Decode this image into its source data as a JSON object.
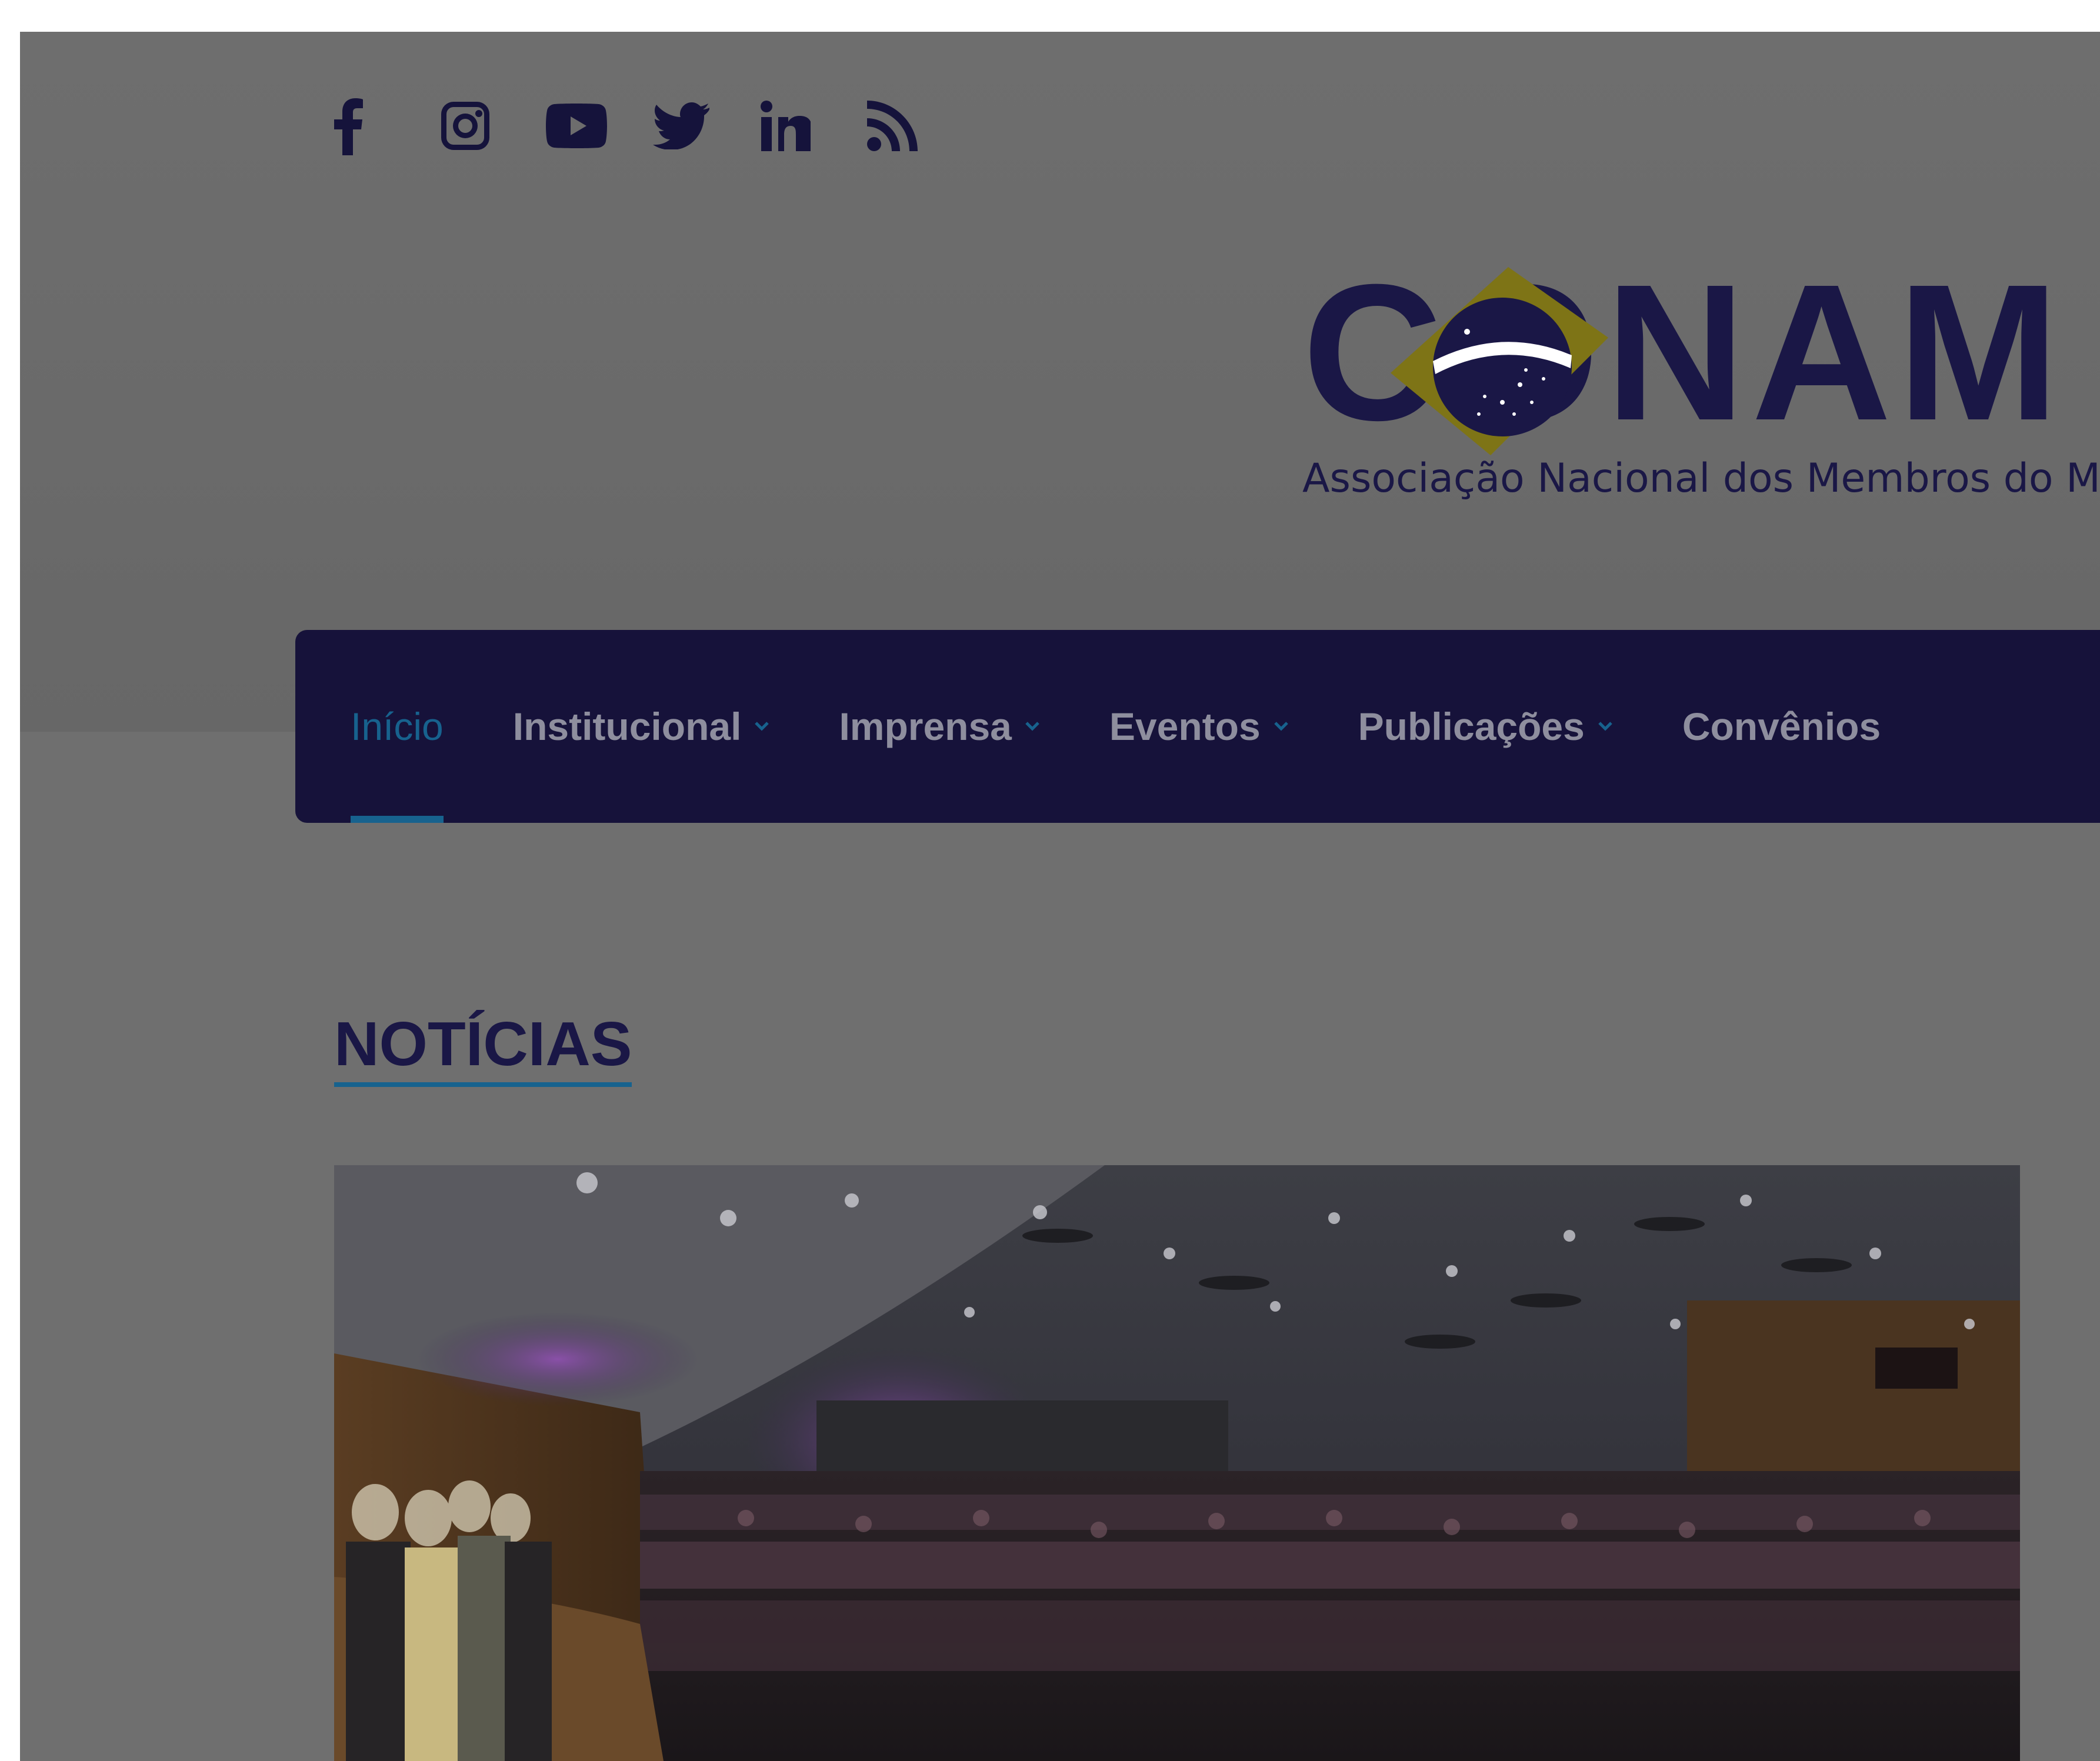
{
  "social": {
    "icons": [
      "facebook-icon",
      "instagram-icon",
      "youtube-icon",
      "twitter-icon",
      "linkedin-icon",
      "rss-icon"
    ]
  },
  "logo": {
    "wordmark": "CONAM",
    "subtitle": "Associação Nacional dos Membros do Minist"
  },
  "nav": {
    "items": [
      {
        "label": "Início",
        "active": true,
        "dropdown": false
      },
      {
        "label": "Institucional",
        "active": false,
        "dropdown": true
      },
      {
        "label": "Imprensa",
        "active": false,
        "dropdown": true
      },
      {
        "label": "Eventos",
        "active": false,
        "dropdown": true
      },
      {
        "label": "Publicações",
        "active": false,
        "dropdown": true
      },
      {
        "label": "Convênios",
        "active": false,
        "dropdown": false
      }
    ]
  },
  "section": {
    "title": "NOTÍCIAS"
  },
  "colors": {
    "brand_navy": "#16123a",
    "accent_blue": "#17628e",
    "overlay_grey": "#6f6f6f"
  }
}
